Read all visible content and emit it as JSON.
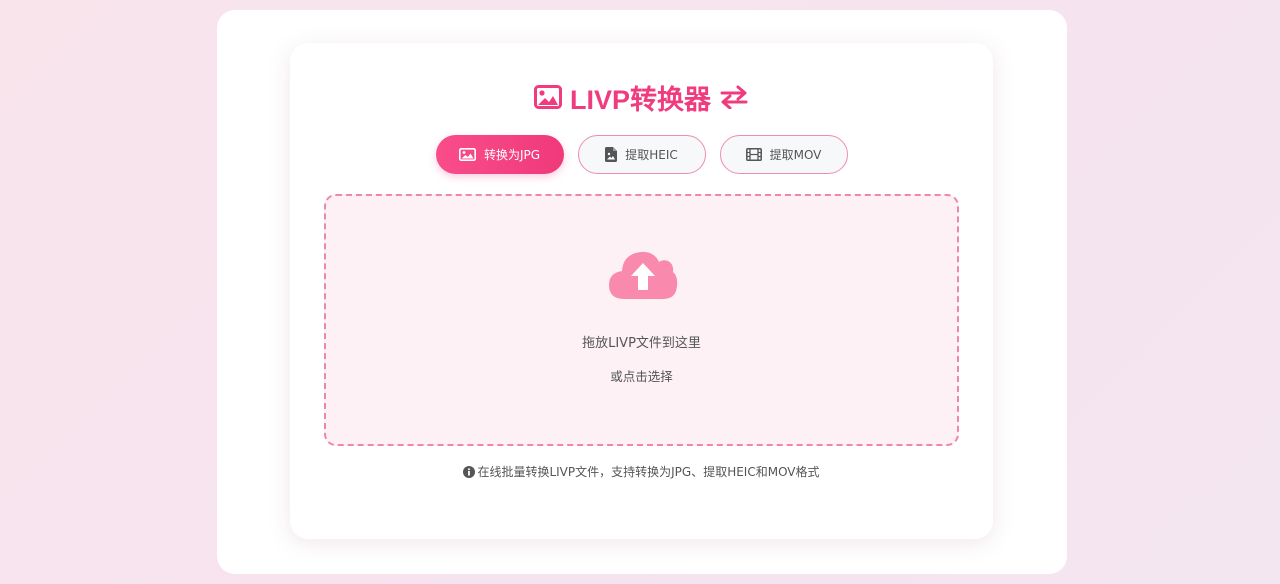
{
  "app": {
    "title": "LIVP转换器",
    "title_icon": "image-icon",
    "swap_icon": "arrows-swap-icon"
  },
  "tabs": [
    {
      "label": "转换为JPG",
      "icon": "image-icon",
      "active": true
    },
    {
      "label": "提取HEIC",
      "icon": "file-image-icon",
      "active": false
    },
    {
      "label": "提取MOV",
      "icon": "film-icon",
      "active": false
    }
  ],
  "dropzone": {
    "icon": "cloud-upload-icon",
    "main_text": "拖放LIVP文件到这里",
    "sub_text": "或点击选择"
  },
  "info": {
    "icon": "info-circle-icon",
    "text": "在线批量转换LIVP文件，支持转换为JPG、提取HEIC和MOV格式"
  },
  "colors": {
    "accent": "#f03c7e",
    "dropzone_border": "#ee88a8",
    "dropzone_bg": "#fdf1f5",
    "cloud": "#f98aae"
  }
}
